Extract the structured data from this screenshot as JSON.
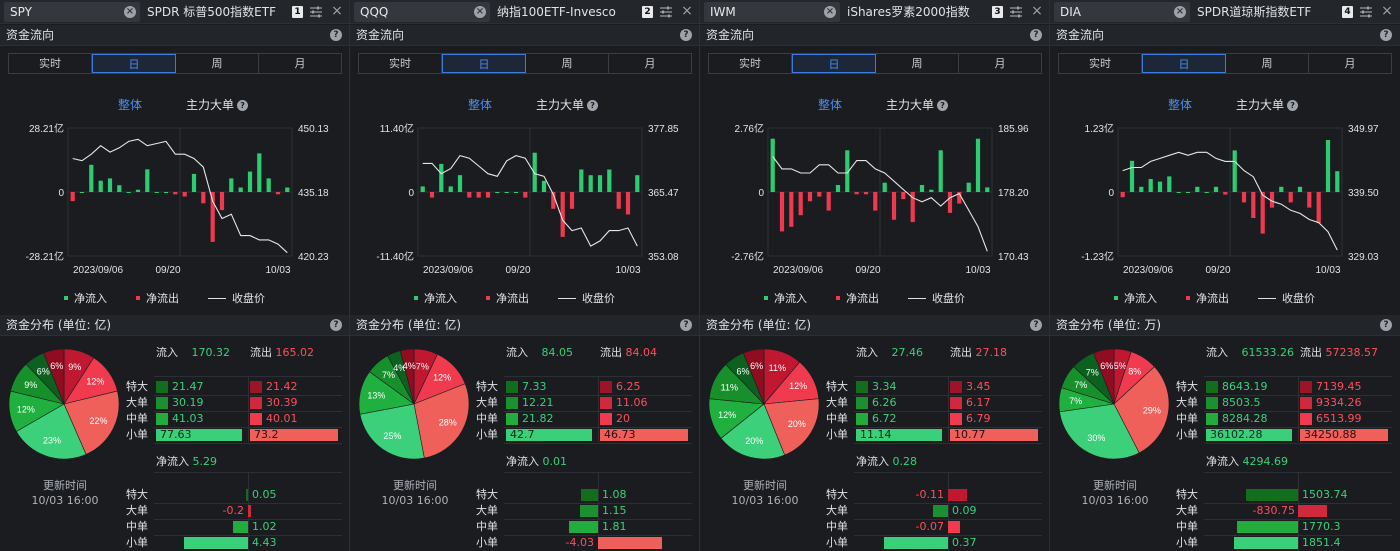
{
  "colors": {
    "up": "#2ecc71",
    "down": "#f0384f",
    "accent": "#4a8ef0"
  },
  "panels": [
    {
      "symbol": "SPY",
      "fund_name": "SPDR 标普500指数ETF",
      "index": "1",
      "flow_title": "资金流向",
      "tabs": [
        "实时",
        "日",
        "周",
        "月"
      ],
      "active_tab": 1,
      "subtab_all": "整体",
      "subtab_main": "主力大单",
      "chart_data": {
        "type": "bar+line",
        "x_labels": [
          "2023/09/06",
          "09/20",
          "10/03"
        ],
        "left_axis": [
          "28.21亿",
          "0",
          "-28.21亿"
        ],
        "right_axis": [
          "450.13",
          "435.18",
          "420.23"
        ],
        "flow_ylim": [
          -28.21,
          28.21
        ],
        "price_ylim": [
          420.23,
          450.13
        ],
        "flows": [
          -4,
          0,
          12,
          5,
          6,
          3,
          0,
          1,
          10,
          0,
          0,
          -1,
          -2,
          8,
          -5,
          -22,
          -8,
          6,
          2,
          9,
          17,
          6,
          -1,
          2
        ],
        "close": [
          443,
          442.5,
          444,
          446,
          444.5,
          445.5,
          447,
          447.5,
          446,
          446.5,
          447,
          444,
          444,
          443,
          441,
          433,
          429,
          430,
          425,
          425,
          424,
          424,
          423,
          421
        ]
      },
      "legend": [
        "净流入",
        "净流出",
        "收盘价"
      ],
      "dist_title": "资金分布 (单位: 亿)",
      "pie": [
        {
          "label": "9%",
          "value": 9,
          "color": "#c01830"
        },
        {
          "label": "12%",
          "value": 12,
          "color": "#f03a4e"
        },
        {
          "label": "22%",
          "value": 22,
          "color": "#f0605a"
        },
        {
          "label": "23%",
          "value": 23,
          "color": "#3cd07a"
        },
        {
          "label": "12%",
          "value": 12,
          "color": "#1fb040"
        },
        {
          "label": "9%",
          "value": 9,
          "color": "#17902c"
        },
        {
          "label": "6%",
          "value": 6,
          "color": "#0c6020"
        },
        {
          "label": "6%",
          "value": 6,
          "color": "#900c20"
        }
      ],
      "inflow_label": "流入",
      "inflow_total": "170.32",
      "outflow_label": "流出",
      "outflow_total": "165.02",
      "rows": [
        {
          "label": "特大",
          "in": "21.47",
          "out": "21.42",
          "in_frac": 0.28,
          "out_frac": 0.29
        },
        {
          "label": "大单",
          "in": "30.19",
          "out": "30.39",
          "in_frac": 0.39,
          "out_frac": 0.42
        },
        {
          "label": "中单",
          "in": "41.03",
          "out": "40.01",
          "in_frac": 0.53,
          "out_frac": 0.55
        },
        {
          "label": "小单",
          "in": "77.63",
          "out": "73.2",
          "in_frac": 1.0,
          "out_frac": 1.0
        }
      ],
      "update_label": "更新时间",
      "update_time": "10/03 16:00",
      "net_label": "净流入",
      "net_total": "5.29",
      "net_rows": [
        {
          "label": "特大",
          "value": "0.05",
          "frac": 0.01
        },
        {
          "label": "大单",
          "value": "-0.2",
          "frac": -0.05
        },
        {
          "label": "中单",
          "value": "1.02",
          "frac": 0.23
        },
        {
          "label": "小单",
          "value": "4.43",
          "frac": 1.0
        }
      ]
    },
    {
      "symbol": "QQQ",
      "fund_name": "纳指100ETF-Invesco",
      "index": "2",
      "flow_title": "资金流向",
      "tabs": [
        "实时",
        "日",
        "周",
        "月"
      ],
      "active_tab": 1,
      "subtab_all": "整体",
      "subtab_main": "主力大单",
      "chart_data": {
        "type": "bar+line",
        "x_labels": [
          "2023/09/06",
          "09/20",
          "10/03"
        ],
        "left_axis": [
          "11.40亿",
          "0",
          "-11.40亿"
        ],
        "right_axis": [
          "377.85",
          "365.47",
          "353.08"
        ],
        "flow_ylim": [
          -11.4,
          11.4
        ],
        "price_ylim": [
          353.08,
          377.85
        ],
        "flows": [
          1,
          -1,
          5,
          1,
          3,
          -1,
          -1,
          -1,
          0,
          0,
          0,
          -1,
          7,
          2,
          -3,
          -8,
          -3,
          4,
          3,
          3,
          4,
          -3,
          -4,
          3
        ],
        "close": [
          371,
          371,
          369,
          370,
          372.5,
          372,
          370.5,
          369,
          368.5,
          371.5,
          372.5,
          372,
          369,
          368.5,
          365,
          360,
          358,
          358.5,
          355,
          356,
          358,
          358,
          358.5,
          355
        ]
      },
      "legend": [
        "净流入",
        "净流出",
        "收盘价"
      ],
      "dist_title": "资金分布 (单位: 亿)",
      "pie": [
        {
          "label": "7%",
          "value": 7,
          "color": "#c01830"
        },
        {
          "label": "12%",
          "value": 12,
          "color": "#f03a4e"
        },
        {
          "label": "28%",
          "value": 28,
          "color": "#f0605a"
        },
        {
          "label": "25%",
          "value": 25,
          "color": "#3cd07a"
        },
        {
          "label": "13%",
          "value": 13,
          "color": "#1fb040"
        },
        {
          "label": "7%",
          "value": 7,
          "color": "#17902c"
        },
        {
          "label": "4%",
          "value": 4,
          "color": "#0c6020"
        },
        {
          "label": "4%",
          "value": 4,
          "color": "#900c20"
        }
      ],
      "inflow_label": "流入",
      "inflow_total": "84.05",
      "outflow_label": "流出",
      "outflow_total": "84.04",
      "rows": [
        {
          "label": "特大",
          "in": "7.33",
          "out": "6.25",
          "in_frac": 0.17,
          "out_frac": 0.13
        },
        {
          "label": "大单",
          "in": "12.21",
          "out": "11.06",
          "in_frac": 0.29,
          "out_frac": 0.24
        },
        {
          "label": "中单",
          "in": "21.82",
          "out": "20",
          "in_frac": 0.51,
          "out_frac": 0.43
        },
        {
          "label": "小单",
          "in": "42.7",
          "out": "46.73",
          "in_frac": 1.0,
          "out_frac": 1.0
        }
      ],
      "update_label": "更新时间",
      "update_time": "10/03 16:00",
      "net_label": "净流入",
      "net_total": "0.01",
      "net_rows": [
        {
          "label": "特大",
          "value": "1.08",
          "frac": 0.27
        },
        {
          "label": "大单",
          "value": "1.15",
          "frac": 0.28
        },
        {
          "label": "中单",
          "value": "1.81",
          "frac": 0.45
        },
        {
          "label": "小单",
          "value": "-4.03",
          "frac": -1.0
        }
      ]
    },
    {
      "symbol": "IWM",
      "fund_name": "iShares罗素2000指数",
      "index": "3",
      "flow_title": "资金流向",
      "tabs": [
        "实时",
        "日",
        "周",
        "月"
      ],
      "active_tab": 1,
      "subtab_all": "整体",
      "subtab_main": "主力大单",
      "chart_data": {
        "type": "bar+line",
        "x_labels": [
          "2023/09/06",
          "09/20",
          "10/03"
        ],
        "left_axis": [
          "2.76亿",
          "0",
          "-2.76亿"
        ],
        "right_axis": [
          "185.96",
          "178.20",
          "170.43"
        ],
        "flow_ylim": [
          -2.76,
          2.76
        ],
        "price_ylim": [
          170.43,
          185.96
        ],
        "flows": [
          2.3,
          -1.7,
          -1.5,
          -1.0,
          -0.4,
          -0.2,
          -0.8,
          0.3,
          1.8,
          -0.1,
          -0.1,
          -0.8,
          0.4,
          -1.2,
          -0.3,
          -1.3,
          0.3,
          0.1,
          1.8,
          -0.9,
          -0.5,
          0.4,
          2.3,
          0.2
        ],
        "close": [
          182.5,
          181,
          181,
          180.5,
          180.5,
          181.5,
          181.5,
          180.5,
          180.5,
          182,
          182,
          181,
          180.5,
          179.5,
          178.5,
          177.5,
          177,
          177.5,
          176.5,
          177.5,
          178,
          176,
          174,
          171
        ]
      },
      "legend": [
        "净流入",
        "净流出",
        "收盘价"
      ],
      "dist_title": "资金分布 (单位: 亿)",
      "pie": [
        {
          "label": "11%",
          "value": 11,
          "color": "#c01830"
        },
        {
          "label": "12%",
          "value": 12,
          "color": "#f03a4e"
        },
        {
          "label": "20%",
          "value": 20,
          "color": "#f0605a"
        },
        {
          "label": "20%",
          "value": 20,
          "color": "#3cd07a"
        },
        {
          "label": "12%",
          "value": 12,
          "color": "#1fb040"
        },
        {
          "label": "11%",
          "value": 11,
          "color": "#17902c"
        },
        {
          "label": "6%",
          "value": 6,
          "color": "#0c6020"
        },
        {
          "label": "6%",
          "value": 6,
          "color": "#900c20"
        }
      ],
      "inflow_label": "流入",
      "inflow_total": "27.46",
      "outflow_label": "流出",
      "outflow_total": "27.18",
      "rows": [
        {
          "label": "特大",
          "in": "3.34",
          "out": "3.45",
          "in_frac": 0.3,
          "out_frac": 0.32
        },
        {
          "label": "大单",
          "in": "6.26",
          "out": "6.17",
          "in_frac": 0.56,
          "out_frac": 0.57
        },
        {
          "label": "中单",
          "in": "6.72",
          "out": "6.79",
          "in_frac": 0.6,
          "out_frac": 0.63
        },
        {
          "label": "小单",
          "in": "11.14",
          "out": "10.77",
          "in_frac": 1.0,
          "out_frac": 1.0
        }
      ],
      "update_label": "更新时间",
      "update_time": "10/03 16:00",
      "net_label": "净流入",
      "net_total": "0.28",
      "net_rows": [
        {
          "label": "特大",
          "value": "-0.11",
          "frac": -0.3
        },
        {
          "label": "大单",
          "value": "0.09",
          "frac": 0.24
        },
        {
          "label": "中单",
          "value": "-0.07",
          "frac": -0.19
        },
        {
          "label": "小单",
          "value": "0.37",
          "frac": 1.0
        }
      ]
    },
    {
      "symbol": "DIA",
      "fund_name": "SPDR道琼斯指数ETF",
      "index": "4",
      "flow_title": "资金流向",
      "tabs": [
        "实时",
        "日",
        "周",
        "月"
      ],
      "active_tab": 1,
      "subtab_all": "整体",
      "subtab_main": "主力大单",
      "chart_data": {
        "type": "bar+line",
        "x_labels": [
          "2023/09/06",
          "09/20",
          "10/03"
        ],
        "left_axis": [
          "1.23亿",
          "0",
          "-1.23亿"
        ],
        "right_axis": [
          "349.97",
          "339.50",
          "329.03"
        ],
        "flow_ylim": [
          -1.23,
          1.23
        ],
        "price_ylim": [
          329.03,
          349.97
        ],
        "flows": [
          -0.1,
          0.6,
          0.1,
          0.25,
          0.2,
          0.3,
          0,
          0,
          0.1,
          0,
          0.1,
          -0.05,
          0.8,
          -0.2,
          -0.5,
          -0.8,
          -0.3,
          0.1,
          -0.2,
          0.1,
          -0.3,
          -0.6,
          1.0,
          0.4
        ],
        "close": [
          343,
          343.5,
          343.5,
          344.5,
          345,
          345.5,
          346,
          345.5,
          346,
          346,
          345,
          344.5,
          344.5,
          343,
          342,
          339,
          338,
          337.5,
          336.5,
          336,
          335,
          334.5,
          333,
          330
        ]
      },
      "legend": [
        "净流入",
        "净流出",
        "收盘价"
      ],
      "dist_title": "资金分布 (单位: 万)",
      "pie": [
        {
          "label": "5%",
          "value": 5,
          "color": "#c01830"
        },
        {
          "label": "8%",
          "value": 8,
          "color": "#f03a4e"
        },
        {
          "label": "29%",
          "value": 29,
          "color": "#f0605a"
        },
        {
          "label": "30%",
          "value": 30,
          "color": "#3cd07a"
        },
        {
          "label": "7%",
          "value": 7,
          "color": "#1fb040"
        },
        {
          "label": "7%",
          "value": 7,
          "color": "#17902c"
        },
        {
          "label": "7%",
          "value": 7,
          "color": "#0c6020"
        },
        {
          "label": "6%",
          "value": 6,
          "color": "#900c20"
        }
      ],
      "inflow_label": "流入",
      "inflow_total": "61533.26",
      "outflow_label": "流出",
      "outflow_total": "57238.57",
      "rows": [
        {
          "label": "特大",
          "in": "8643.19",
          "out": "7139.45",
          "in_frac": 0.24,
          "out_frac": 0.21
        },
        {
          "label": "大单",
          "in": "8503.5",
          "out": "9334.26",
          "in_frac": 0.24,
          "out_frac": 0.27
        },
        {
          "label": "中单",
          "in": "8284.28",
          "out": "6513.99",
          "in_frac": 0.23,
          "out_frac": 0.19
        },
        {
          "label": "小单",
          "in": "36102.28",
          "out": "34250.88",
          "in_frac": 1.0,
          "out_frac": 1.0
        }
      ],
      "update_label": "更新时间",
      "update_time": "10/03 16:00",
      "net_label": "净流入",
      "net_total": "4294.69",
      "net_rows": [
        {
          "label": "特大",
          "value": "1503.74",
          "frac": 0.81
        },
        {
          "label": "大单",
          "value": "-830.75",
          "frac": -0.45
        },
        {
          "label": "中单",
          "value": "1770.3",
          "frac": 0.96
        },
        {
          "label": "小单",
          "value": "1851.4",
          "frac": 1.0
        }
      ]
    }
  ]
}
